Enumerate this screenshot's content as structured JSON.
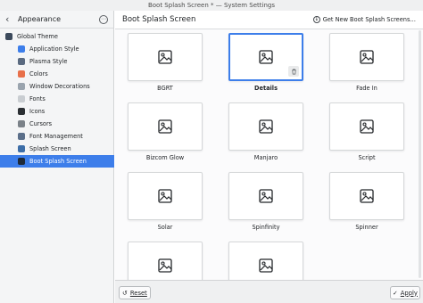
{
  "window": {
    "title": "Boot Splash Screen * — System Settings"
  },
  "sidebar": {
    "back_label": "Appearance",
    "items": [
      {
        "label": "Global Theme",
        "icon": "global-theme-icon",
        "color": "#3c4a5c"
      },
      {
        "label": "Application Style",
        "icon": "application-style-icon",
        "color": "#3d7eea"
      },
      {
        "label": "Plasma Style",
        "icon": "plasma-style-icon",
        "color": "#5a6a80"
      },
      {
        "label": "Colors",
        "icon": "colors-icon",
        "color": "#e8704a"
      },
      {
        "label": "Window Decorations",
        "icon": "window-decorations-icon",
        "color": "#9aa4ae"
      },
      {
        "label": "Fonts",
        "icon": "fonts-icon",
        "color": "#c9cdd1"
      },
      {
        "label": "Icons",
        "icon": "icons-icon",
        "color": "#2b2f33"
      },
      {
        "label": "Cursors",
        "icon": "cursors-icon",
        "color": "#7b8289"
      },
      {
        "label": "Font Management",
        "icon": "font-management-icon",
        "color": "#5b6f8a"
      },
      {
        "label": "Splash Screen",
        "icon": "splash-screen-icon",
        "color": "#3d6ea8"
      },
      {
        "label": "Boot Splash Screen",
        "icon": "boot-splash-screen-icon",
        "color": "#1e2a3a"
      }
    ],
    "selected_index": 10
  },
  "header": {
    "title": "Boot Splash Screen",
    "get_new_label": "Get New Boot Splash Screens…"
  },
  "themes": [
    {
      "name": "BGRT"
    },
    {
      "name": "Details"
    },
    {
      "name": "Fade In"
    },
    {
      "name": "Bizcom Glow"
    },
    {
      "name": "Manjaro"
    },
    {
      "name": "Script"
    },
    {
      "name": "Solar"
    },
    {
      "name": "Spinfinity"
    },
    {
      "name": "Spinner"
    },
    {
      "name": ""
    },
    {
      "name": ""
    }
  ],
  "selected_theme_index": 1,
  "footer": {
    "reset_label": "Reset",
    "apply_label": "Apply"
  },
  "colors": {
    "accent": "#3d7eea",
    "sidebar_bg": "#f4f5f6"
  }
}
